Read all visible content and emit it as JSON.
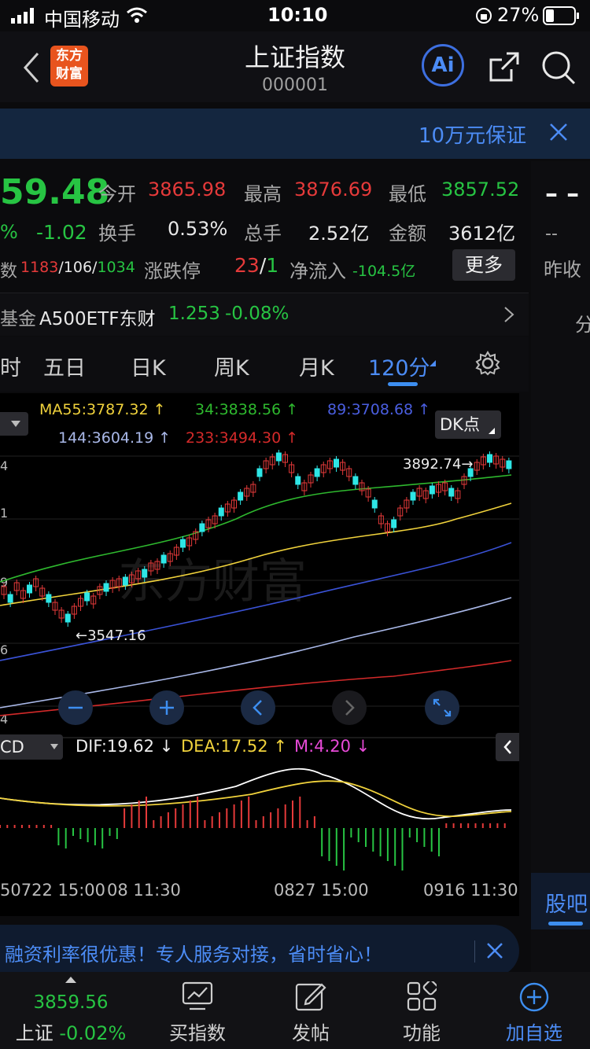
{
  "status_bar": {
    "carrier": "中国移动",
    "time": "10:10",
    "battery": "27%"
  },
  "header": {
    "title": "上证指数",
    "code": "000001",
    "logo_line1": "东方",
    "logo_line2": "财富",
    "ai_label": "Ai"
  },
  "banner": {
    "text": "10万元保证"
  },
  "quote": {
    "price": "59.48",
    "change_pct_partial": "%",
    "change": "-1.02",
    "open_label": "今开",
    "open": "3865.98",
    "high_label": "最高",
    "high": "3876.69",
    "low_label": "最低",
    "low": "3857.52",
    "turnover_label": "换手",
    "turnover": "0.53%",
    "volume_label": "总手",
    "volume": "2.52亿",
    "amount_label": "金额",
    "amount": "3612亿",
    "breadth_label": "数",
    "breadth_up": "1183",
    "breadth_flat": "/106/",
    "breadth_down": "1034",
    "limit_label": "涨跌停",
    "limit_up": "23",
    "limit_sep": "/",
    "limit_down": "1",
    "netflow_label": "净流入",
    "netflow": "-104.5亿",
    "more_button": "更多"
  },
  "right_panel": {
    "dash1": "– –",
    "dash2": "--",
    "prev_close_label": "昨收",
    "char_fen": "分",
    "guba_label": "股吧"
  },
  "fund_row": {
    "label": "基金",
    "name": "A500ETF东财",
    "price": "1.253",
    "change": "-0.08%"
  },
  "tabs": [
    {
      "label": "时"
    },
    {
      "label": "五日"
    },
    {
      "label": "日K"
    },
    {
      "label": "周K"
    },
    {
      "label": "月K"
    },
    {
      "label": "120分"
    }
  ],
  "ma_legend": {
    "ma55": "MA55:3787.32",
    "ma34": "34:3838.56",
    "ma89": "89:3708.68",
    "ma144": "144:3604.19",
    "ma233": "233:3494.30",
    "dk_button": "DK点"
  },
  "colors": {
    "ma55": "#f0d23c",
    "ma34": "#2eb82e",
    "ma89": "#3a52d6",
    "ma144": "#a9b8e8",
    "ma233": "#d42a2a",
    "up": "#e53a3a",
    "down": "#2ee6e6",
    "accent": "#3d8ef0"
  },
  "chart": {
    "y_labels": [
      "4",
      "1",
      "9",
      "6",
      "4"
    ],
    "high_mark": "3892.74",
    "low_mark": "3547.16",
    "x_labels": [
      "50722 15:00",
      "08 11:30",
      "0827 15:00",
      "0916 11:30"
    ],
    "watermark": "东方财富"
  },
  "macd": {
    "selector": "CD",
    "dif": "DIF:19.62",
    "dea": "DEA:17.52",
    "m": "M:4.20"
  },
  "bottom_banner": {
    "text": "融资利率很优惠！专人服务对接，省时省心！"
  },
  "bottom_nav": {
    "index_price": "3859.56",
    "index_name": "上证",
    "index_change": "-0.02%",
    "items": [
      {
        "label": "买指数",
        "icon": "chart-icon"
      },
      {
        "label": "发帖",
        "icon": "edit-icon"
      },
      {
        "label": "功能",
        "icon": "grid-icon"
      },
      {
        "label": "加自选",
        "icon": "plus-circle-icon"
      }
    ]
  }
}
